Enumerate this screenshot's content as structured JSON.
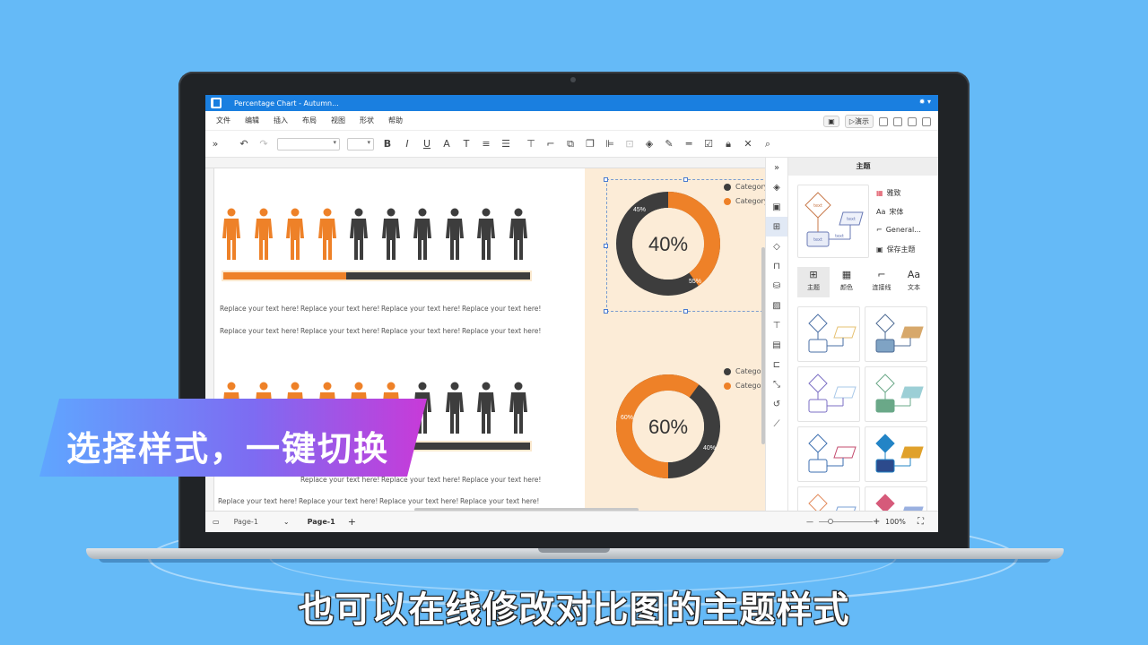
{
  "app": {
    "window_title": "Percentage Chart - Autumn...",
    "menus": [
      "文件",
      "编辑",
      "插入",
      "布局",
      "视图",
      "形状",
      "帮助"
    ],
    "present_label": "演示"
  },
  "colors": {
    "accent": "#1a7fe0",
    "orange": "#ee8128",
    "dark": "#3d3d3d",
    "panel_bg": "#fcecd7",
    "background": "#65baf7"
  },
  "canvas": {
    "infographic_1": {
      "people_highlighted": 4,
      "people_total": 10,
      "progress": 0.4
    },
    "infographic_2": {
      "people_highlighted": 6,
      "people_total": 10,
      "progress": 0.6
    },
    "placeholder": "Replace your text here!",
    "donut_1": {
      "center_label": "40%",
      "orange_label": "45%",
      "dark_label": "55%",
      "orange_value": 40,
      "legend": [
        "Category",
        "Category"
      ]
    },
    "donut_2": {
      "center_label": "60%",
      "orange_label": "60%",
      "dark_label": "40%",
      "orange_value": 60,
      "legend": [
        "Category",
        "Category"
      ]
    }
  },
  "panel": {
    "title": "主题",
    "options": [
      "雅致",
      "宋体",
      "General...",
      "保存主题"
    ],
    "tabs": [
      "主题",
      "颜色",
      "连接线",
      "文本"
    ],
    "preview_labels": [
      "text",
      "text",
      "text",
      "text"
    ]
  },
  "status": {
    "page_selector": "Page-1",
    "active_page": "Page-1",
    "zoom": "100%"
  },
  "overlay": {
    "banner": "选择样式，一键切换",
    "subtitle": "也可以在线修改对比图的主题样式"
  }
}
